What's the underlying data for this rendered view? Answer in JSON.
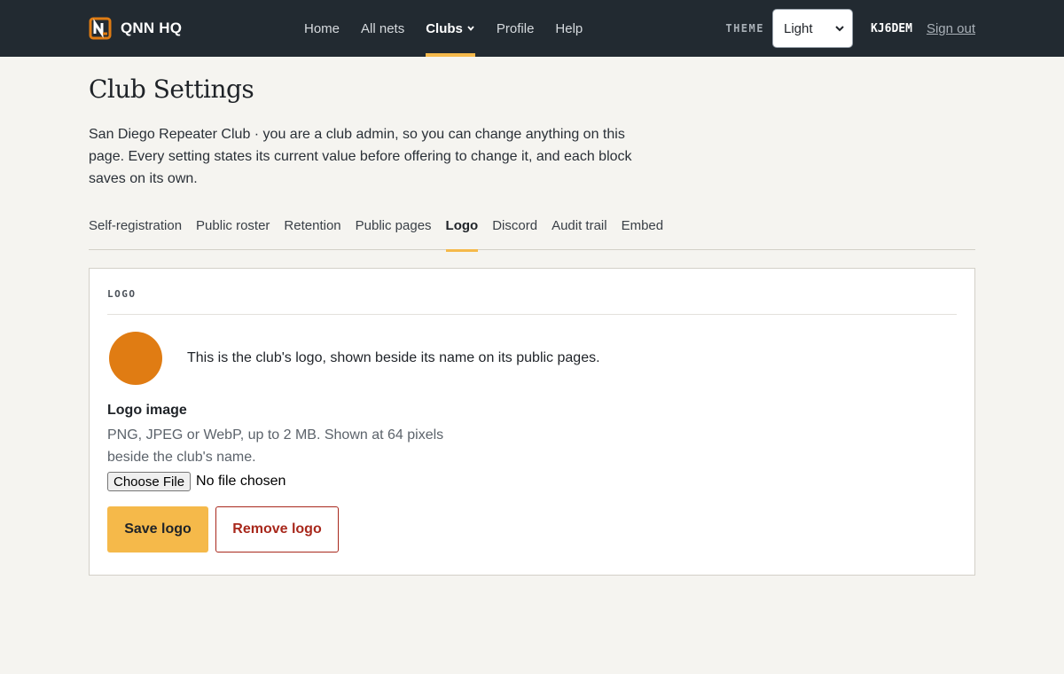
{
  "header": {
    "brand_name": "QNN HQ",
    "nav": [
      {
        "label": "Home"
      },
      {
        "label": "All nets"
      },
      {
        "label": "Clubs"
      },
      {
        "label": "Profile"
      },
      {
        "label": "Help"
      }
    ],
    "active_nav": "Clubs",
    "theme_label": "THEME",
    "theme_value": "Light",
    "callsign": "KJ6DEM",
    "sign_out": "Sign out"
  },
  "page": {
    "title": "Club Settings",
    "intro": "San Diego Repeater Club · you are a club admin, so you can change anything on this page. Every setting states its current value before offering to change it, and each block saves on its own."
  },
  "tabs": [
    {
      "label": "Self-registration"
    },
    {
      "label": "Public roster"
    },
    {
      "label": "Retention"
    },
    {
      "label": "Public pages"
    },
    {
      "label": "Logo"
    },
    {
      "label": "Discord"
    },
    {
      "label": "Audit trail"
    },
    {
      "label": "Embed"
    }
  ],
  "active_tab": "Logo",
  "logo_card": {
    "title": "LOGO",
    "description": "This is the club's logo, shown beside its name on its public pages.",
    "field_label": "Logo image",
    "help": "PNG, JPEG or WebP, up to 2 MB. Shown at 64 pixels beside the club's name.",
    "file_button": "Choose File",
    "file_status": "No file chosen",
    "save_label": "Save logo",
    "remove_label": "Remove logo"
  },
  "colors": {
    "accent": "#f5b94a",
    "header_bg": "#222a31",
    "club_logo": "#e07c13",
    "danger": "#a8281c"
  }
}
